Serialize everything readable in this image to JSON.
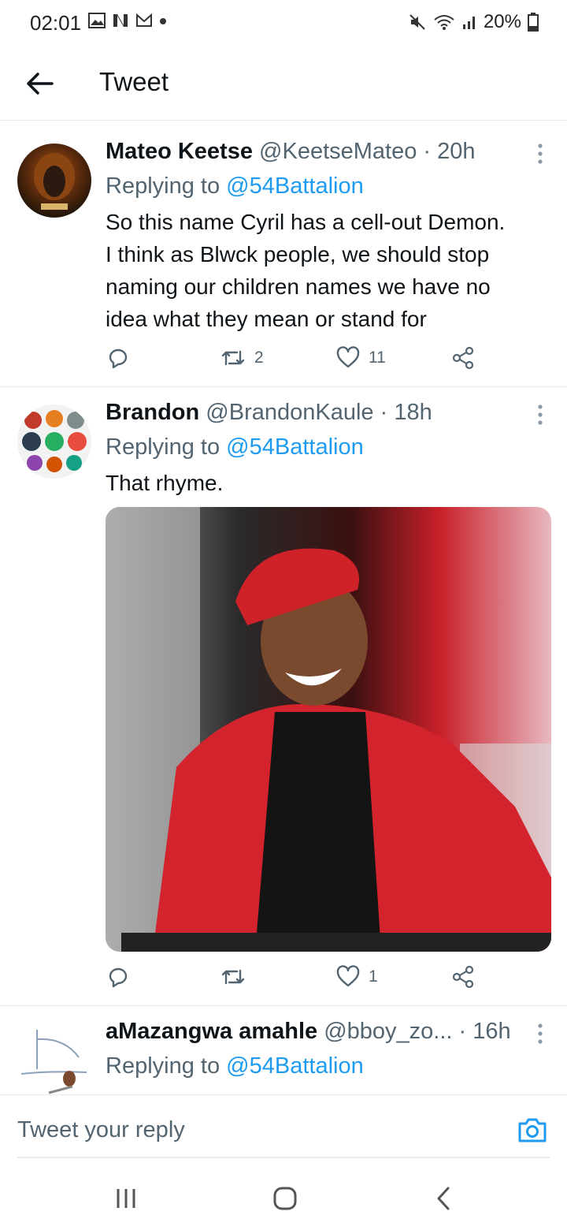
{
  "status_bar": {
    "time": "02:01",
    "battery": "20%"
  },
  "header": {
    "title": "Tweet"
  },
  "tweets": [
    {
      "name": "Mateo Keetse",
      "handle": "@KeetseMateo",
      "separator": "·",
      "time": "20h",
      "replying_label": "Replying to",
      "replying_to": "@54Battalion",
      "lines": [
        "So this name Cyril has a cell-out Demon.",
        "I think as Blwck people, we should stop",
        "naming our children names we have no",
        "idea what they mean or stand for"
      ],
      "retweets": "2",
      "likes": "11"
    },
    {
      "name": "Brandon",
      "handle": "@BrandonKaule",
      "separator": "·",
      "time": "18h",
      "replying_label": "Replying to",
      "replying_to": "@54Battalion",
      "lines": [
        "That rhyme."
      ],
      "retweets": "",
      "likes": "1"
    },
    {
      "name": "aMazangwa amahle",
      "handle": "@bboy_zo...",
      "separator": "·",
      "time": "16h",
      "replying_label": "Replying to",
      "replying_to": "@54Battalion"
    }
  ],
  "reply_box": {
    "placeholder": "Tweet your reply"
  },
  "colors": {
    "accent": "#1d9bf0",
    "text": "#0f1419",
    "muted": "#536471",
    "divider": "#e6ecf0"
  }
}
